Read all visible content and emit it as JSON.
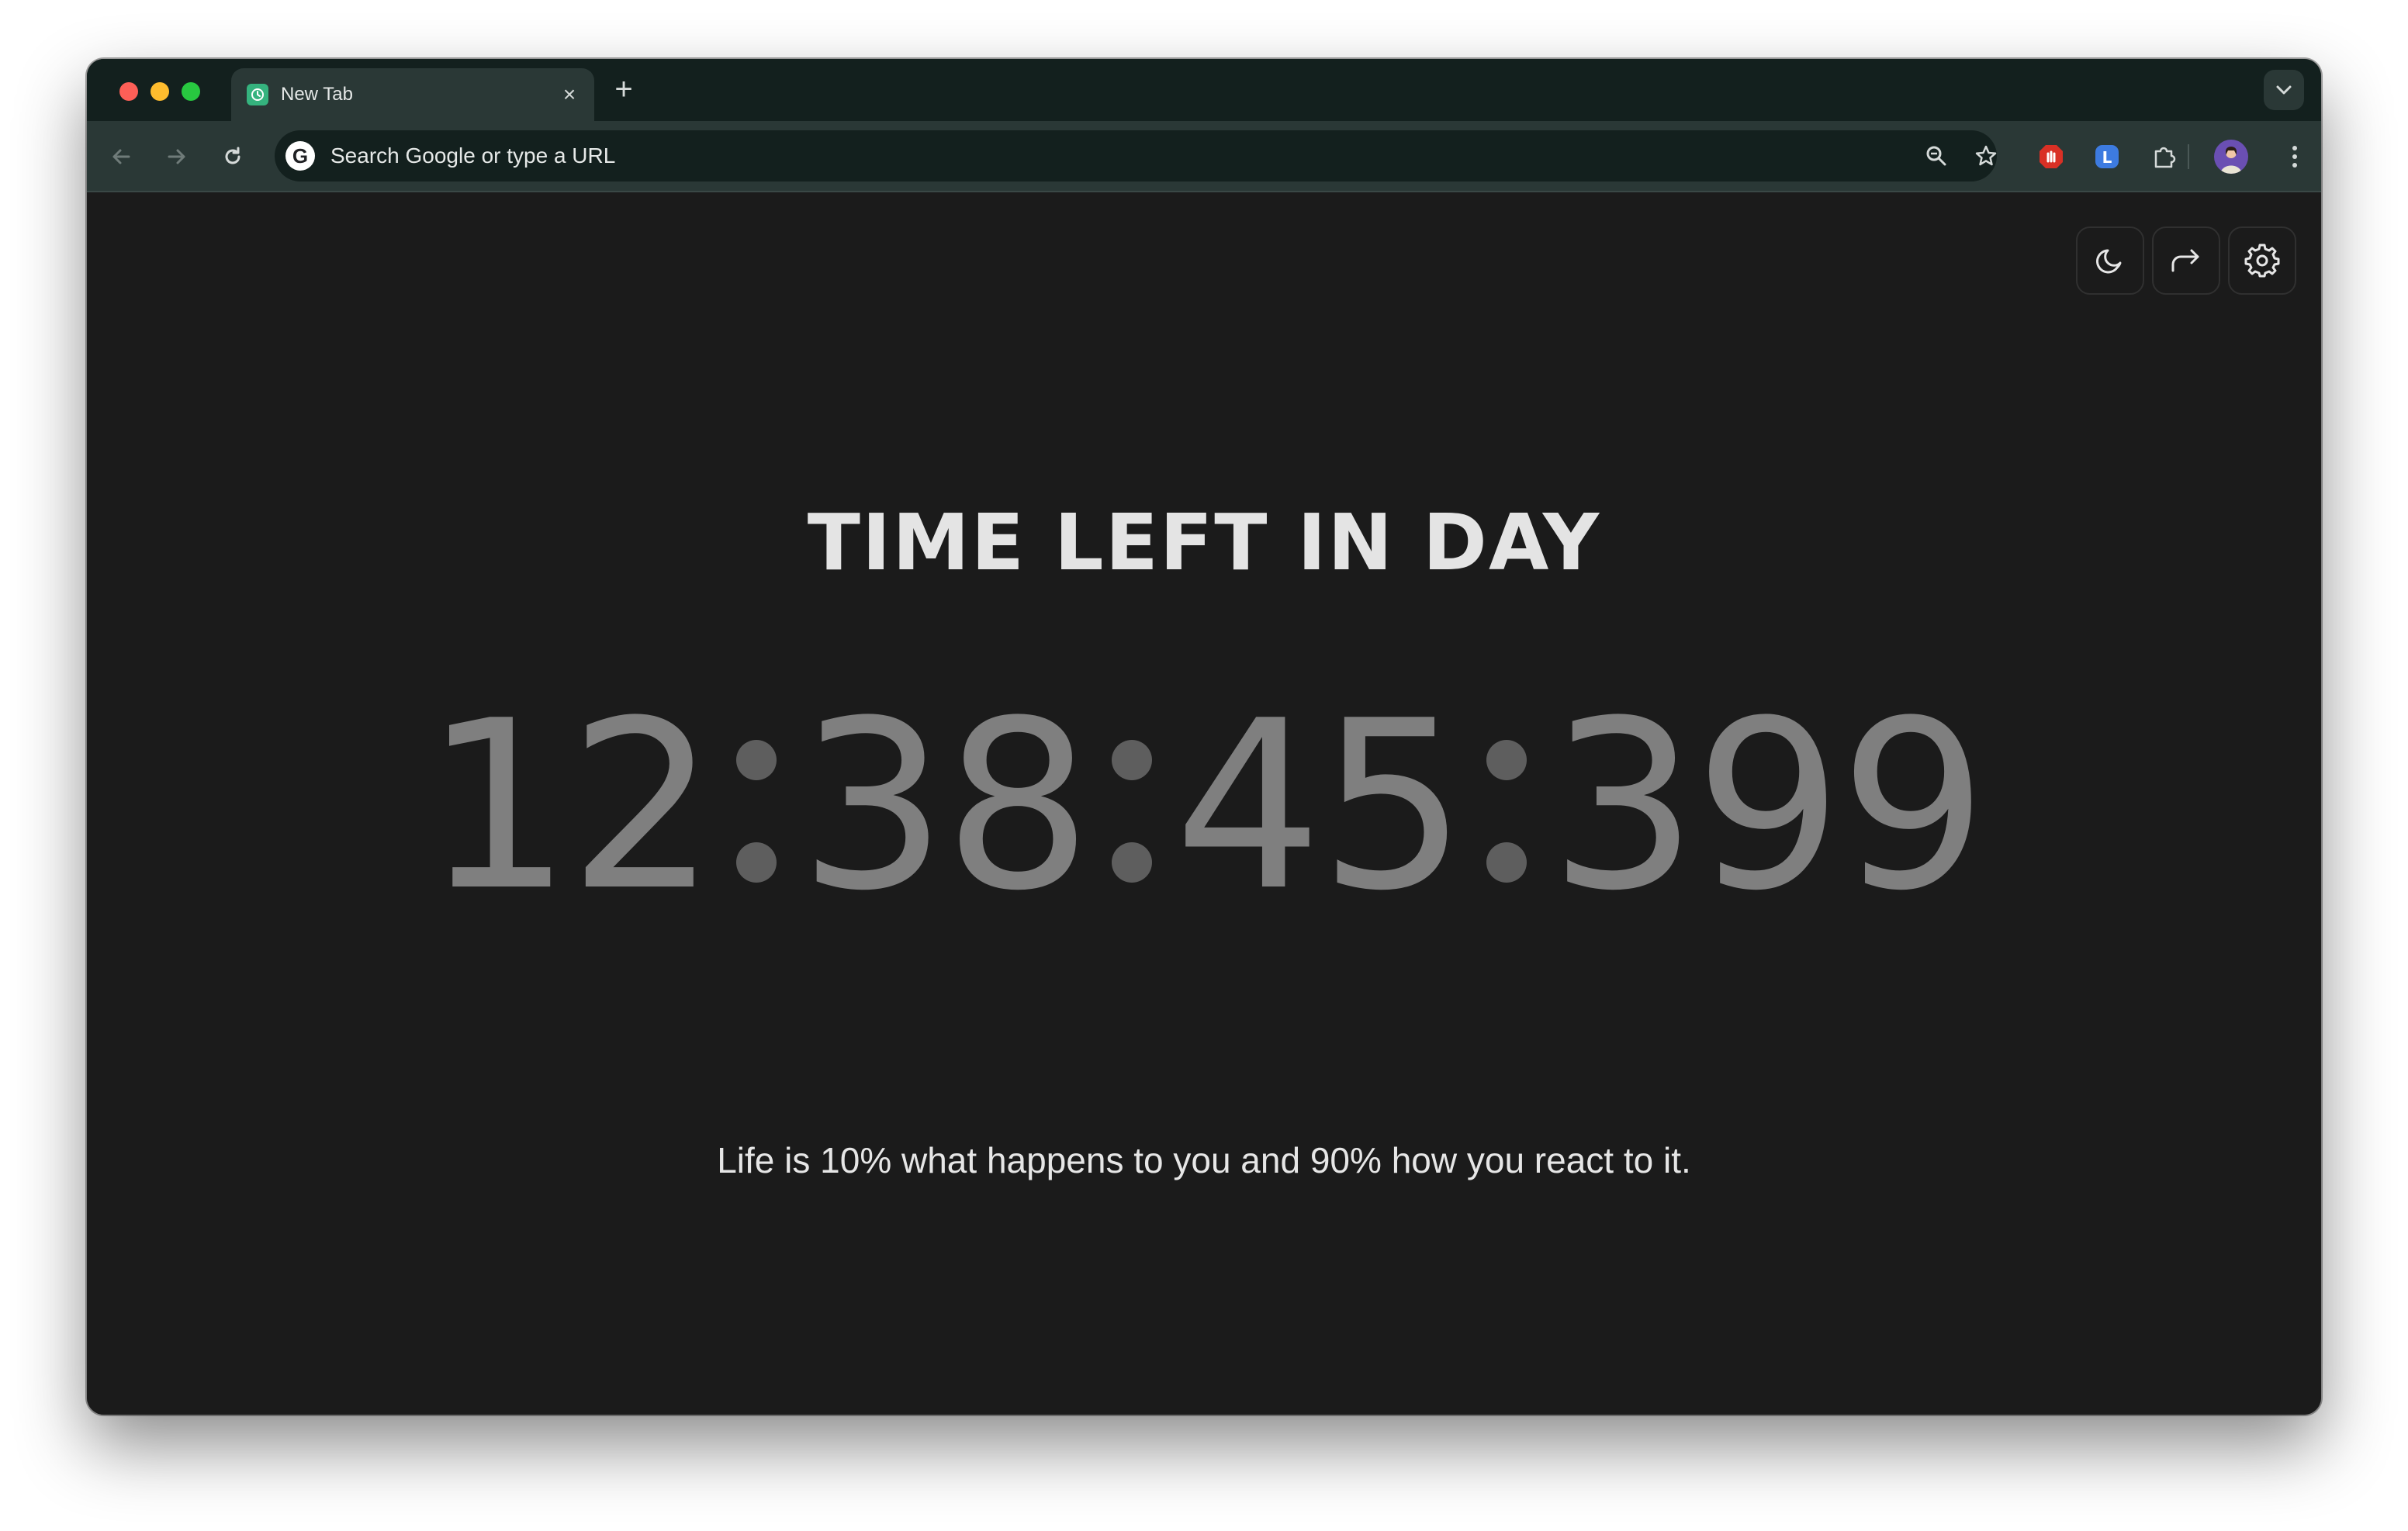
{
  "browser": {
    "tab": {
      "title": "New Tab",
      "close_glyph": "×"
    },
    "new_tab_glyph": "+",
    "omnibox": {
      "placeholder": "Search Google or type a URL",
      "google_glyph": "G"
    }
  },
  "page": {
    "heading": "TIME LEFT IN DAY",
    "countdown": {
      "hours": "12",
      "minutes": "38",
      "seconds": "45",
      "milliseconds": "399"
    },
    "quote": "Life is 10% what happens to you and 90% how you react to it."
  },
  "icons": {
    "theme": "moon-icon",
    "share": "share-arrow-icon",
    "settings": "gear-icon"
  },
  "colors": {
    "page_background": "#1b1b1b",
    "countdown_digits": "#7f7f7f",
    "heading": "#e4e4e4",
    "browser_frame": "#13201e"
  }
}
